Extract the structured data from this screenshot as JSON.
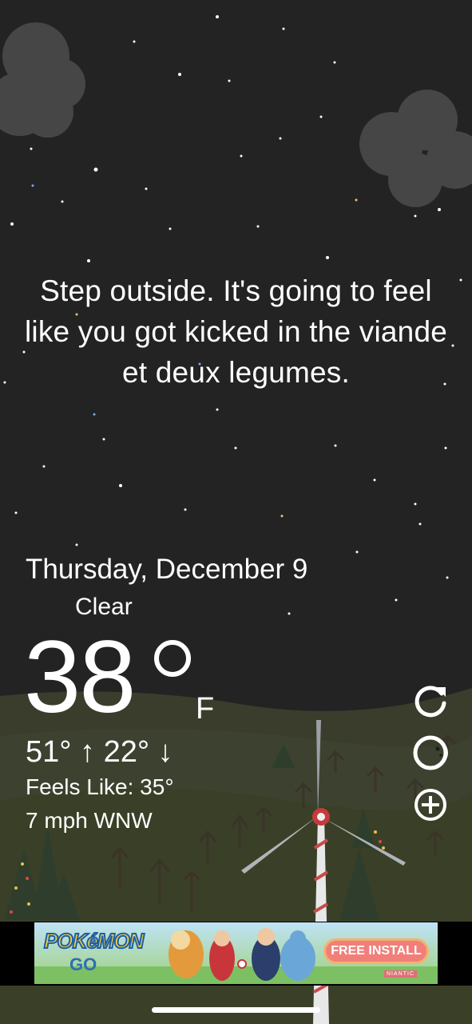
{
  "app": {
    "quote": "Step outside. It's going to feel like you got kicked in the viande et deux legumes."
  },
  "weather": {
    "date": "Thursday, December 9",
    "condition": "Clear",
    "condition_icon": "crescent-moon-icon",
    "temperature": "38",
    "unit": "F",
    "high_low": "51° ↑ 22° ↓",
    "feels_like": "Feels Like: 35°",
    "wind": "7 mph WNW"
  },
  "controls": {
    "refresh_icon": "refresh-icon",
    "moon_phase_icon": "moon-phase-icon",
    "add_icon": "add-circle-icon"
  },
  "ad": {
    "brand_word": "POKéMON",
    "brand_go": "GO",
    "cta": "FREE INSTALL",
    "publisher": "NIANTIC"
  },
  "colors": {
    "sky": "#222222",
    "moon_accent": "#3a73d8",
    "cta_fill": "#f07f7a"
  }
}
